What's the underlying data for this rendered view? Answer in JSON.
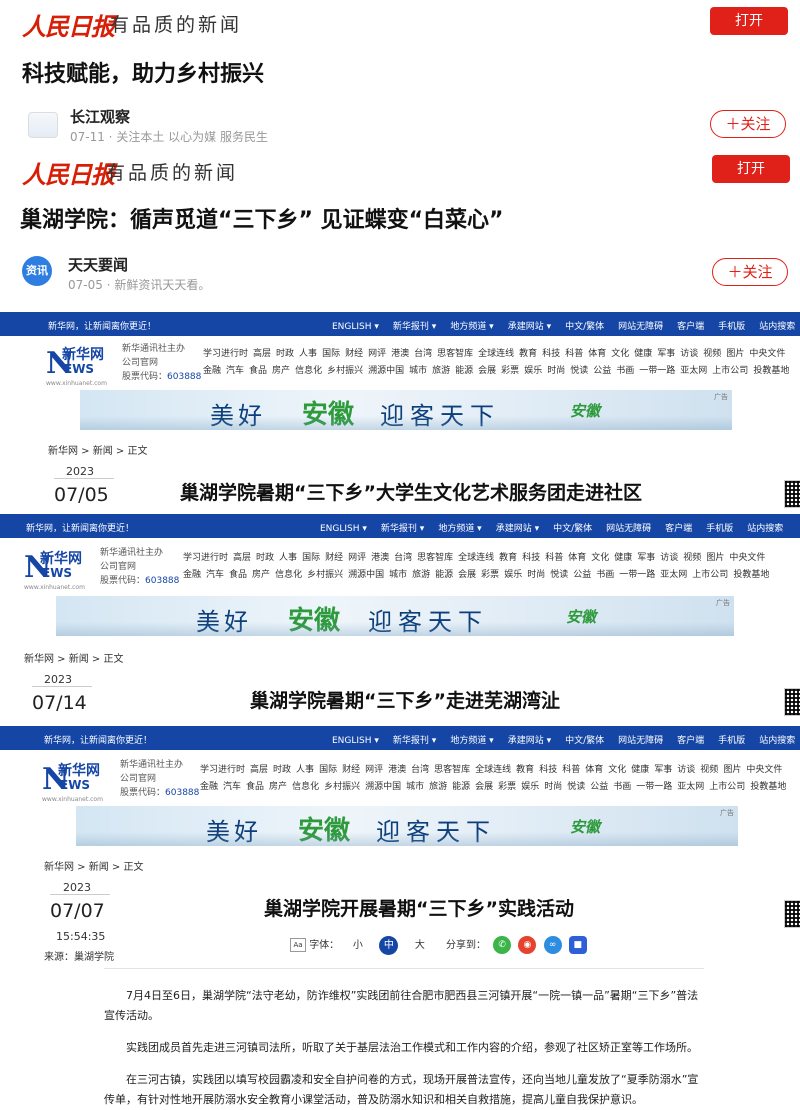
{
  "card1": {
    "logo": "人民日报",
    "slogan": "有品质的新闻",
    "open_label": "打开",
    "title": "科技赋能，助力乡村振兴",
    "author": "长江观察",
    "meta": "07-11 · 关注本土 以心为媒 服务民生",
    "follow_label": "＋关注"
  },
  "card2": {
    "logo": "人民日报",
    "slogan": "有品质的新闻",
    "open_label": "打开",
    "title": "巢湖学院：循声觅道“三下乡” 见证蝶变“白菜心”",
    "author_badge": "资讯",
    "author": "天天要闻",
    "meta": "07-05 · 新鲜资讯天天看。",
    "follow_label": "＋关注"
  },
  "xinhua": {
    "welcome": "新华网，让新闻离你更近！",
    "nav": [
      "ENGLISH ▾",
      "新华报刊 ▾",
      "地方频道 ▾",
      "承建网站 ▾",
      "中文/繁体",
      "网站无障碍",
      "客户端",
      "手机版",
      "站内搜索"
    ],
    "logo_url": "www.news.cn",
    "logo_cn": "新华网",
    "logo_en": "EWS",
    "logo_sub": "www.xinhuanet.com",
    "org": "新华通讯社主办",
    "site": "公司官网",
    "stock": "股票代码：",
    "stock_code": "603888",
    "menu1": [
      "学习进行时",
      "高层",
      "时政",
      "人事",
      "国际",
      "财经",
      "网评",
      "港澳",
      "台湾",
      "思客智库",
      "全球连线",
      "教育",
      "科技",
      "科普",
      "体育",
      "文化",
      "健康",
      "军事",
      "访谈",
      "视频",
      "图片",
      "中央文件"
    ],
    "menu2": [
      "金融",
      "汽车",
      "食品",
      "房产",
      "信息化",
      "乡村振兴",
      "溯源中国",
      "城市",
      "旅游",
      "能源",
      "会展",
      "彩票",
      "娱乐",
      "时尚",
      "悦读",
      "公益",
      "书画",
      "一带一路",
      "亚太网",
      "上市公司",
      "投教基地"
    ],
    "banner": {
      "a": "美好",
      "b": "安徽",
      "c": "迎客天下",
      "d": "安徽",
      "ad": "广告"
    },
    "crumb": "新华网 > 新闻 > 正文",
    "year": "2023"
  },
  "article1": {
    "date": "07/05",
    "headline": "巢湖学院暑期“三下乡”大学生文化艺术服务团走进社区"
  },
  "article2": {
    "date": "07/14",
    "headline": "巢湖学院暑期“三下乡”走进芜湖湾沚"
  },
  "article3": {
    "date": "07/07",
    "time": "15:54:35",
    "source": "来源：巢湖学院",
    "headline": "巢湖学院开展暑期“三下乡”实践活动",
    "font_label": "字体：",
    "sizes": [
      "小",
      "中",
      "大"
    ],
    "share_label": "分享到：",
    "paragraphs": [
      "7月4日至6日，巢湖学院“法守老幼，防诈维权”实践团前往合肥市肥西县三河镇开展“一院一镇一品”暑期“三下乡”普法宣传活动。",
      "实践团成员首先走进三河镇司法所，听取了关于基层法治工作模式和工作内容的介绍，参观了社区矫正室等工作场所。",
      "在三河古镇，实践团以填写校园霸凌和安全自护问卷的方式，现场开展普法宣传，还向当地儿童发放了“夏季防溺水”宣传单，有针对性地开展防溺水安全教育小课堂活动，普及防溺水知识和相关自救措施，提高儿童自我保护意识。"
    ]
  }
}
